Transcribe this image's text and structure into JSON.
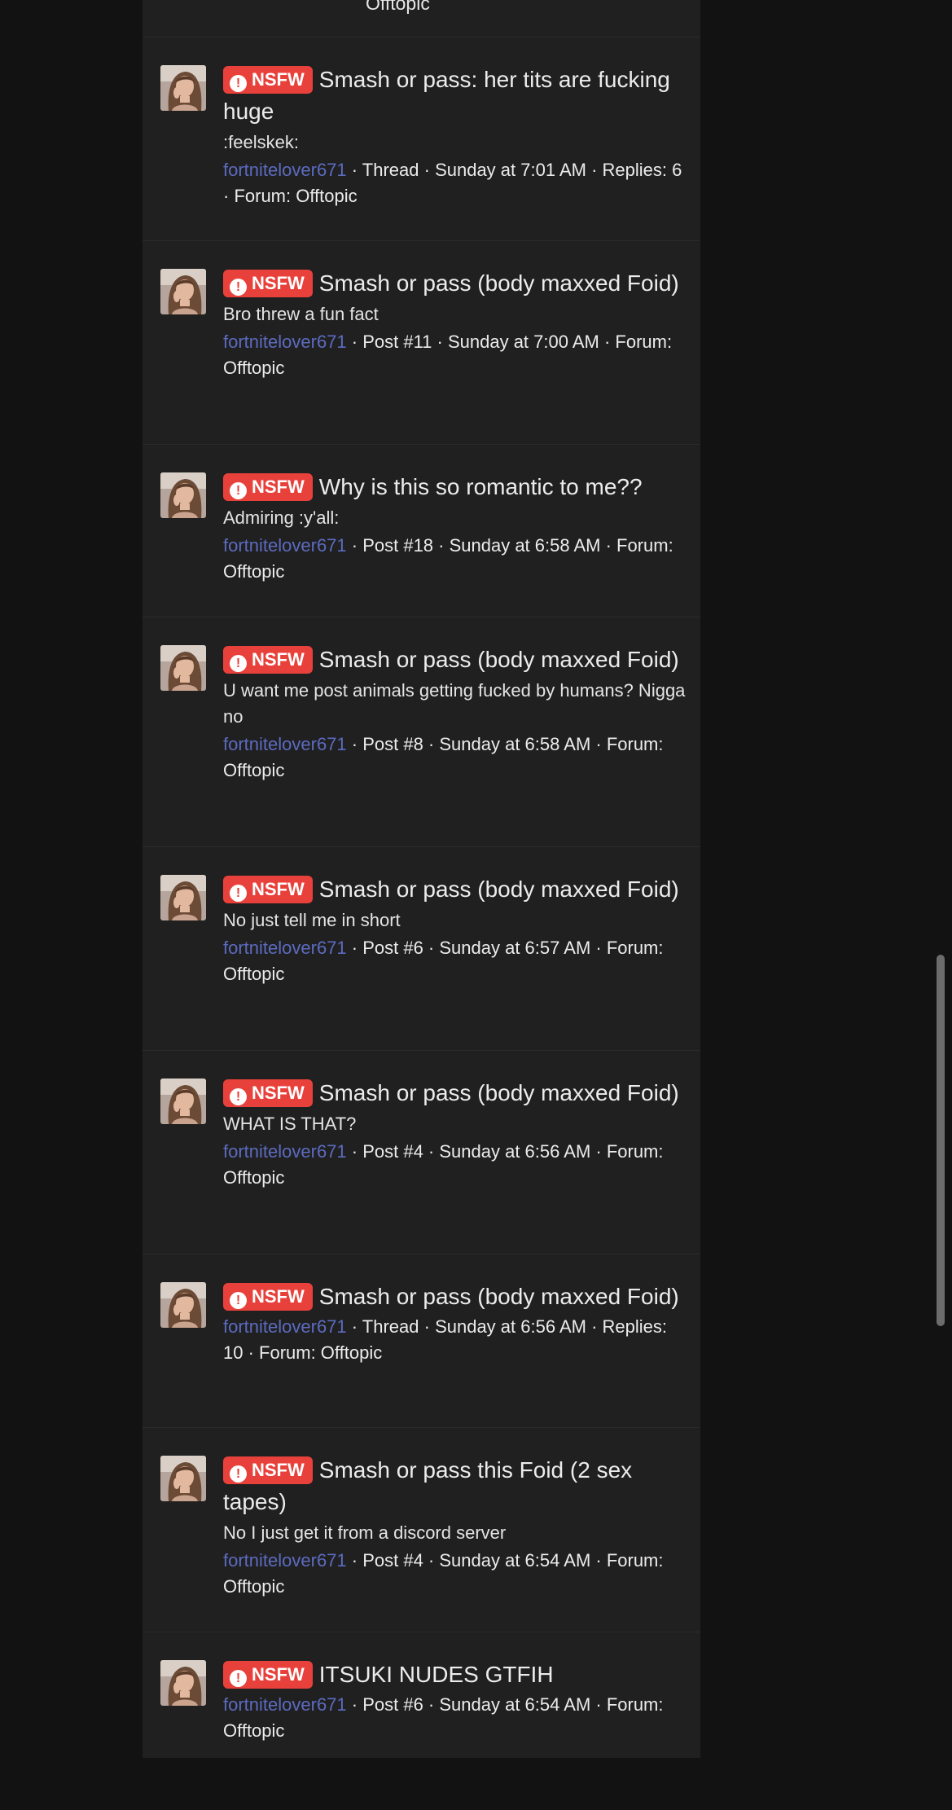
{
  "partial_top": "Offtopic",
  "badge_label": "NSFW",
  "results": [
    {
      "title": "Smash or pass: her tits are fucking huge",
      "snippet": ":feelskek:",
      "author": "fortnitelover671",
      "meta": " · Thread · Sunday at 7:01 AM · Replies: 6 · Forum: Offtopic"
    },
    {
      "title": "Smash or pass (body maxxed Foid)",
      "snippet": "Bro threw a fun fact",
      "author": "fortnitelover671",
      "meta": " · Post #11 · Sunday at 7:00 AM · Forum: Offtopic"
    },
    {
      "title": "Why is this so romantic to me??",
      "snippet": "Admiring :y'all:",
      "author": "fortnitelover671",
      "meta": " · Post #18 · Sunday at 6:58 AM · Forum: Offtopic"
    },
    {
      "title": "Smash or pass (body maxxed Foid)",
      "snippet": "U want me post animals getting fucked by humans? Nigga no",
      "author": "fortnitelover671",
      "meta": " · Post #8 · Sunday at 6:58 AM · Forum: Offtopic"
    },
    {
      "title": "Smash or pass (body maxxed Foid)",
      "snippet": "No just tell me in short",
      "author": "fortnitelover671",
      "meta": " · Post #6 · Sunday at 6:57 AM · Forum: Offtopic"
    },
    {
      "title": "Smash or pass (body maxxed Foid)",
      "snippet": "WHAT IS THAT?",
      "author": "fortnitelover671",
      "meta": " · Post #4 · Sunday at 6:56 AM · Forum: Offtopic"
    },
    {
      "title": "Smash or pass (body maxxed Foid)",
      "snippet": "",
      "author": "fortnitelover671",
      "meta": " · Thread · Sunday at 6:56 AM · Replies: 10 · Forum: Offtopic"
    },
    {
      "title": "Smash or pass this Foid (2 sex tapes)",
      "snippet": "No I just get it from a discord server",
      "author": "fortnitelover671",
      "meta": " · Post #4 · Sunday at 6:54 AM · Forum: Offtopic"
    },
    {
      "title": "ITSUKI NUDES GTFIH",
      "snippet": "",
      "author": "fortnitelover671",
      "meta": " · Post #6 · Sunday at 6:54 AM · Forum: Offtopic"
    }
  ],
  "colors": {
    "background": "#121212",
    "panel": "#202020",
    "nsfw_badge": "#e8413b",
    "author_link": "#5c6bc0"
  }
}
